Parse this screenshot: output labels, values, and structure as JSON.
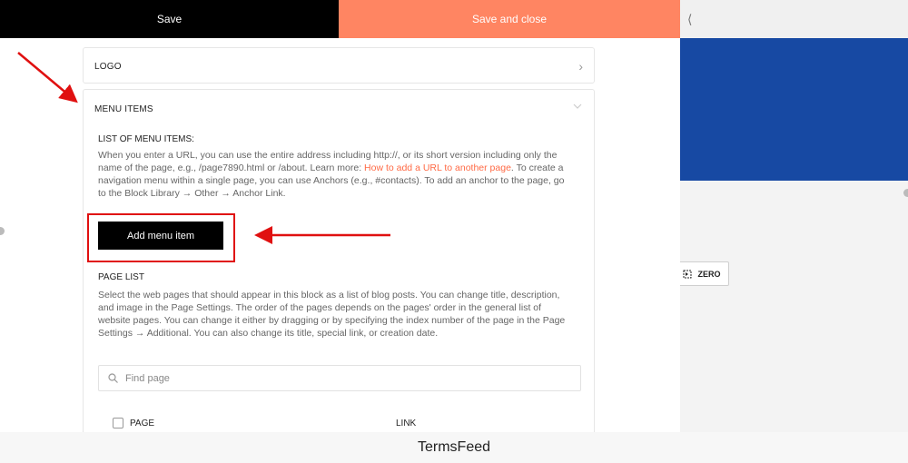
{
  "toolbar": {
    "save_label": "Save",
    "save_close_label": "Save and close",
    "collapse_label": "⟨"
  },
  "sections": {
    "logo": {
      "title": "LOGO"
    },
    "menu_items": {
      "title": "MENU ITEMS",
      "list_title": "LIST OF MENU ITEMS:",
      "list_desc_before": "When you enter a URL, you can use the entire address including http://, or its short version including only the name of the page, e.g., /page7890.html or /about. Learn more: ",
      "list_desc_link": "How to add a URL to another page",
      "list_desc_after": ". To create a navigation menu within a single page, you can use Anchors (e.g., #contacts). To add an anchor to the page, go to the Block Library → Other → Anchor Link.",
      "add_button_label": "Add menu item",
      "page_list_title": "PAGE LIST",
      "page_list_desc": "Select the web pages that should appear in this block as a list of blog posts. You can change title, description, and image in the Page Settings. The order of the pages depends on the pages' order in the general list of website pages. You can change it either by dragging or by specifying the index number of the page in the Page Settings → Additional. You can also change its title, special link, or creation date.",
      "search_placeholder": "Find page",
      "columns": [
        "PAGE",
        "LINK"
      ]
    }
  },
  "preview": {
    "zero_label": "ZERO",
    "accent_color": "#1749a3"
  },
  "footer": {
    "brand": "TermsFeed"
  },
  "colors": {
    "save_bg": "#000000",
    "save_close_bg": "#ff8562",
    "annotation": "#e01010"
  }
}
